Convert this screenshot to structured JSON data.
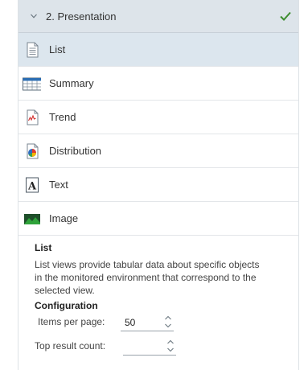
{
  "section": {
    "title": "2. Presentation"
  },
  "items": [
    {
      "label": "List",
      "icon": "list-icon"
    },
    {
      "label": "Summary",
      "icon": "summary-table-icon"
    },
    {
      "label": "Trend",
      "icon": "trend-chart-icon"
    },
    {
      "label": "Distribution",
      "icon": "pie-chart-icon"
    },
    {
      "label": "Text",
      "icon": "text-icon"
    },
    {
      "label": "Image",
      "icon": "image-icon"
    }
  ],
  "selected": "List",
  "description": {
    "title": "List",
    "text": "List views provide tabular data about specific objects in the monitored environment that correspond to the selected view.",
    "config_title": "Configuration",
    "items_per_page_label": "Items per page:",
    "items_per_page_value": "50",
    "top_result_label": "Top result count:",
    "top_result_value": ""
  },
  "colors": {
    "accent": "#3c8c2e",
    "selected_bg": "#dce6ee",
    "header_bg": "#dde4ea"
  }
}
